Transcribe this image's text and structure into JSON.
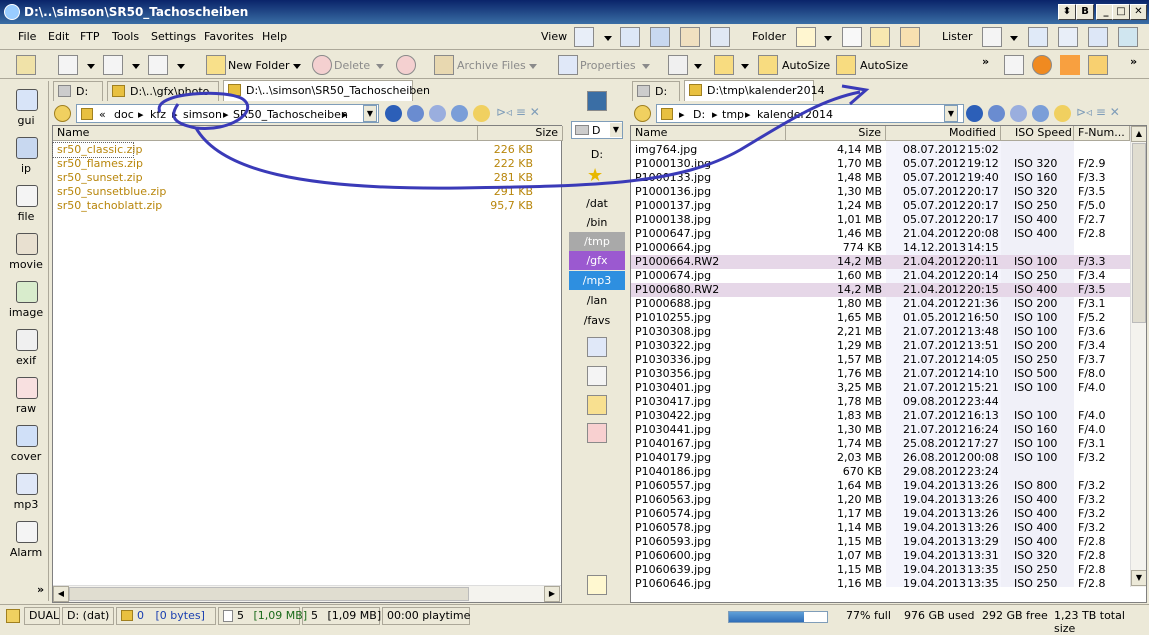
{
  "window": {
    "title": "D:\\..\\simson\\SR50_Tachoscheiben"
  },
  "menu": {
    "file": "File",
    "edit": "Edit",
    "ftp": "FTP",
    "tools": "Tools",
    "settings": "Settings",
    "favorites": "Favorites",
    "help": "Help",
    "view": "View",
    "folder": "Folder",
    "lister": "Lister"
  },
  "toolbar": {
    "new_folder": "New Folder",
    "delete": "Delete",
    "archive_files": "Archive Files",
    "properties": "Properties",
    "autosize1": "AutoSize",
    "autosize2": "AutoSize"
  },
  "left_bar": [
    {
      "label": "gui"
    },
    {
      "label": "ip"
    },
    {
      "label": "file"
    },
    {
      "label": "movie"
    },
    {
      "label": "image"
    },
    {
      "label": "exif"
    },
    {
      "label": "raw"
    },
    {
      "label": "cover"
    },
    {
      "label": "mp3"
    },
    {
      "label": "Alarm"
    }
  ],
  "left_pane": {
    "tabs": [
      "D:",
      "D:\\..\\gfx\\photo",
      "D:\\..\\simson\\SR50_Tachoscheiben"
    ],
    "path": {
      "prefix": "«",
      "c1": "doc",
      "c2": "kfz",
      "c3": "simson",
      "c4": "SR50_Tachoscheiben"
    },
    "columns": {
      "name": "Name",
      "size": "Size"
    },
    "files": [
      {
        "name": "sr50_classic.zip",
        "size": "226 KB"
      },
      {
        "name": "sr50_flames.zip",
        "size": "222 KB"
      },
      {
        "name": "sr50_sunset.zip",
        "size": "281 KB"
      },
      {
        "name": "sr50_sunsetblue.zip",
        "size": "291 KB"
      },
      {
        "name": "sr50_tachoblatt.zip",
        "size": "95,7 KB"
      }
    ]
  },
  "middle_bar": {
    "drive": "D",
    "drive_label": "D:",
    "favs": [
      "/dat",
      "/bin",
      "/tmp",
      "/gfx",
      "/mp3",
      "/lan",
      "/favs"
    ]
  },
  "right_pane": {
    "tabs": [
      "D:",
      "D:\\tmp\\kalender2014"
    ],
    "path": {
      "c1": "D:",
      "c2": "tmp",
      "c3": "kalender2014"
    },
    "columns": {
      "name": "Name",
      "size": "Size",
      "modified": "Modified",
      "iso": "ISO Speed",
      "fnum": "F-Num..."
    },
    "files": [
      {
        "name": "img764.jpg",
        "size": "4,14 MB",
        "date": "08.07.2012",
        "time": "15:02",
        "iso": "",
        "f": ""
      },
      {
        "name": "P1000130.jpg",
        "size": "1,70 MB",
        "date": "05.07.2012",
        "time": "19:12",
        "iso": "ISO 320",
        "f": "F/2.9"
      },
      {
        "name": "P1000133.jpg",
        "size": "1,48 MB",
        "date": "05.07.2012",
        "time": "19:40",
        "iso": "ISO 160",
        "f": "F/3.3"
      },
      {
        "name": "P1000136.jpg",
        "size": "1,30 MB",
        "date": "05.07.2012",
        "time": "20:17",
        "iso": "ISO 320",
        "f": "F/3.5"
      },
      {
        "name": "P1000137.jpg",
        "size": "1,24 MB",
        "date": "05.07.2012",
        "time": "20:17",
        "iso": "ISO 250",
        "f": "F/5.0"
      },
      {
        "name": "P1000138.jpg",
        "size": "1,01 MB",
        "date": "05.07.2012",
        "time": "20:17",
        "iso": "ISO 400",
        "f": "F/2.7"
      },
      {
        "name": "P1000647.jpg",
        "size": "1,46 MB",
        "date": "21.04.2012",
        "time": "20:08",
        "iso": "ISO 400",
        "f": "F/2.8"
      },
      {
        "name": "P1000664.jpg",
        "size": "774 KB",
        "date": "14.12.2013",
        "time": "14:15",
        "iso": "",
        "f": ""
      },
      {
        "name": "P1000664.RW2",
        "size": "14,2 MB",
        "date": "21.04.2012",
        "time": "20:11",
        "iso": "ISO 100",
        "f": "F/3.3",
        "raw": true
      },
      {
        "name": "P1000674.jpg",
        "size": "1,60 MB",
        "date": "21.04.2012",
        "time": "20:14",
        "iso": "ISO 250",
        "f": "F/3.4"
      },
      {
        "name": "P1000680.RW2",
        "size": "14,2 MB",
        "date": "21.04.2012",
        "time": "20:15",
        "iso": "ISO 400",
        "f": "F/3.5",
        "raw": true
      },
      {
        "name": "P1000688.jpg",
        "size": "1,80 MB",
        "date": "21.04.2012",
        "time": "21:36",
        "iso": "ISO 200",
        "f": "F/3.1"
      },
      {
        "name": "P1010255.jpg",
        "size": "1,65 MB",
        "date": "01.05.2012",
        "time": "16:50",
        "iso": "ISO 100",
        "f": "F/5.2"
      },
      {
        "name": "P1030308.jpg",
        "size": "2,21 MB",
        "date": "21.07.2012",
        "time": "13:48",
        "iso": "ISO 100",
        "f": "F/3.6"
      },
      {
        "name": "P1030322.jpg",
        "size": "1,29 MB",
        "date": "21.07.2012",
        "time": "13:51",
        "iso": "ISO 200",
        "f": "F/3.4"
      },
      {
        "name": "P1030336.jpg",
        "size": "1,57 MB",
        "date": "21.07.2012",
        "time": "14:05",
        "iso": "ISO 250",
        "f": "F/3.7"
      },
      {
        "name": "P1030356.jpg",
        "size": "1,76 MB",
        "date": "21.07.2012",
        "time": "14:10",
        "iso": "ISO 500",
        "f": "F/8.0"
      },
      {
        "name": "P1030401.jpg",
        "size": "3,25 MB",
        "date": "21.07.2012",
        "time": "15:21",
        "iso": "ISO 100",
        "f": "F/4.0"
      },
      {
        "name": "P1030417.jpg",
        "size": "1,78 MB",
        "date": "09.08.2012",
        "time": "23:44",
        "iso": "",
        "f": ""
      },
      {
        "name": "P1030422.jpg",
        "size": "1,83 MB",
        "date": "21.07.2012",
        "time": "16:13",
        "iso": "ISO 100",
        "f": "F/4.0"
      },
      {
        "name": "P1030441.jpg",
        "size": "1,30 MB",
        "date": "21.07.2012",
        "time": "16:24",
        "iso": "ISO 160",
        "f": "F/4.0"
      },
      {
        "name": "P1040167.jpg",
        "size": "1,74 MB",
        "date": "25.08.2012",
        "time": "17:27",
        "iso": "ISO 100",
        "f": "F/3.1"
      },
      {
        "name": "P1040179.jpg",
        "size": "2,03 MB",
        "date": "26.08.2012",
        "time": "00:08",
        "iso": "ISO 100",
        "f": "F/3.2"
      },
      {
        "name": "P1040186.jpg",
        "size": "670 KB",
        "date": "29.08.2012",
        "time": "23:24",
        "iso": "",
        "f": ""
      },
      {
        "name": "P1060557.jpg",
        "size": "1,64 MB",
        "date": "19.04.2013",
        "time": "13:26",
        "iso": "ISO 800",
        "f": "F/3.2"
      },
      {
        "name": "P1060563.jpg",
        "size": "1,20 MB",
        "date": "19.04.2013",
        "time": "13:26",
        "iso": "ISO 400",
        "f": "F/3.2"
      },
      {
        "name": "P1060574.jpg",
        "size": "1,17 MB",
        "date": "19.04.2013",
        "time": "13:26",
        "iso": "ISO 400",
        "f": "F/3.2"
      },
      {
        "name": "P1060578.jpg",
        "size": "1,14 MB",
        "date": "19.04.2013",
        "time": "13:26",
        "iso": "ISO 400",
        "f": "F/3.2"
      },
      {
        "name": "P1060593.jpg",
        "size": "1,15 MB",
        "date": "19.04.2013",
        "time": "13:29",
        "iso": "ISO 400",
        "f": "F/2.8"
      },
      {
        "name": "P1060600.jpg",
        "size": "1,07 MB",
        "date": "19.04.2013",
        "time": "13:31",
        "iso": "ISO 320",
        "f": "F/2.8"
      },
      {
        "name": "P1060639.jpg",
        "size": "1,15 MB",
        "date": "19.04.2013",
        "time": "13:35",
        "iso": "ISO 250",
        "f": "F/2.8"
      },
      {
        "name": "P1060646.jpg",
        "size": "1,16 MB",
        "date": "19.04.2013",
        "time": "13:35",
        "iso": "ISO 250",
        "f": "F/2.8"
      }
    ]
  },
  "status": {
    "mode": "DUAL",
    "drive": "D: (dat)",
    "folders": "0",
    "bytes": "[0 bytes]",
    "files": "5",
    "files_size": "[1,09 MB]",
    "sel": "5",
    "sel_size": "[1,09 MB]",
    "playtime": "00:00 playtime",
    "fill_fraction": 0.77,
    "full": "77% full",
    "used": "976 GB used",
    "free": "292 GB free",
    "total": "1,23 TB total size"
  },
  "colors": {
    "title_start": "#0a246a",
    "title_end": "#3a6ea5",
    "zip_text": "#b8860b",
    "raw_row": "#e6d7e8",
    "fav_tmp": "#a9a9a9",
    "fav_gfx": "#9b59d0",
    "fav_mp3": "#2e8fe0",
    "annotation": "#3a3ab8"
  }
}
